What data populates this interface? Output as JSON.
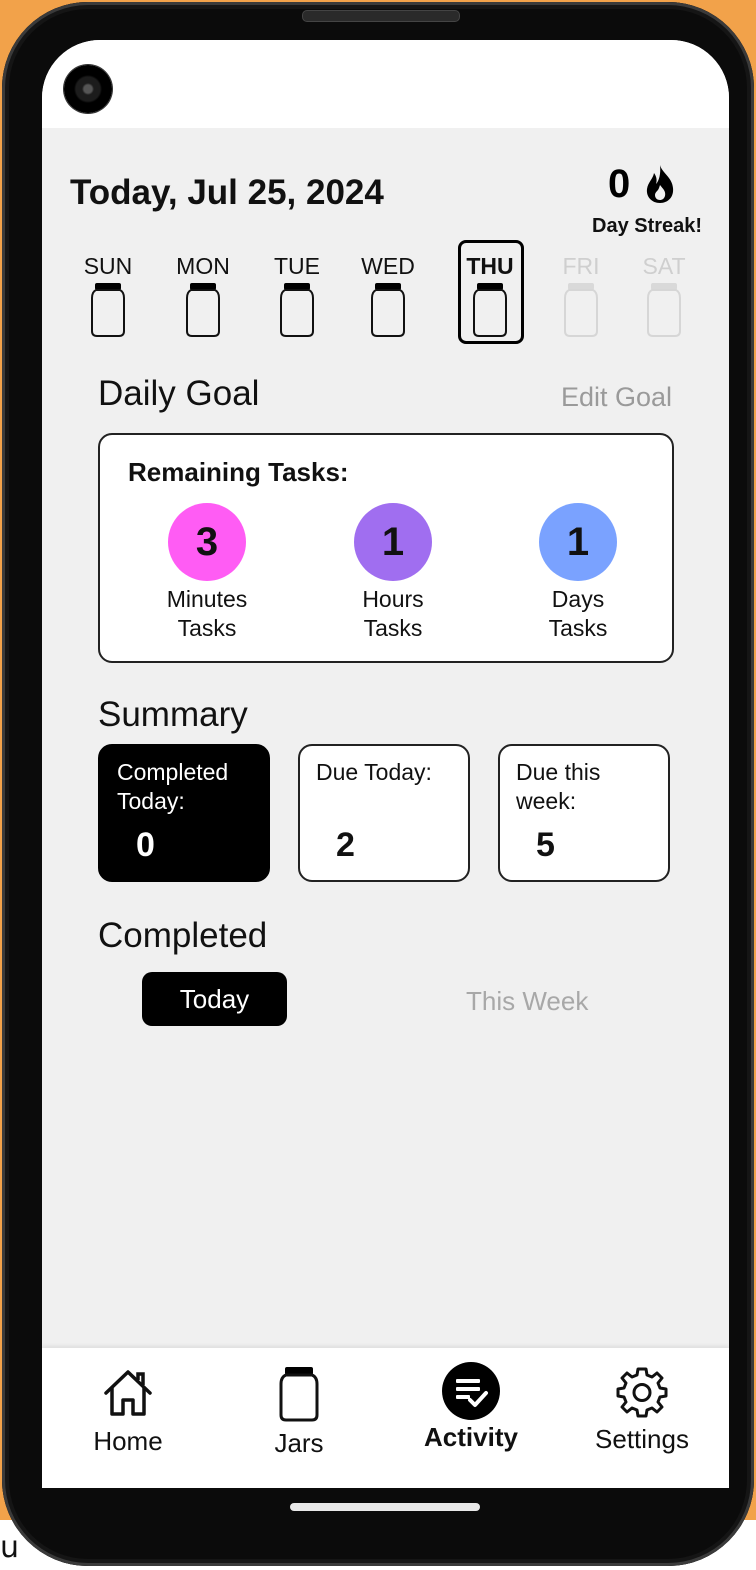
{
  "header": {
    "date": "Today, Jul 25, 2024",
    "streak_count": "0",
    "streak_label": "Day Streak!",
    "streak_icon": "flame-icon"
  },
  "week": [
    {
      "label": "SUN",
      "state": "filled"
    },
    {
      "label": "MON",
      "state": "filled"
    },
    {
      "label": "TUE",
      "state": "filled"
    },
    {
      "label": "WED",
      "state": "filled"
    },
    {
      "label": "THU",
      "state": "current"
    },
    {
      "label": "FRI",
      "state": "future"
    },
    {
      "label": "SAT",
      "state": "future"
    }
  ],
  "daily_goal": {
    "title": "Daily Goal",
    "edit_label": "Edit Goal",
    "card_heading": "Remaining Tasks:",
    "tasks": [
      {
        "count": "3",
        "label_line1": "Minutes",
        "label_line2": "Tasks",
        "color": "#ff5cf4"
      },
      {
        "count": "1",
        "label_line1": "Hours",
        "label_line2": "Tasks",
        "color": "#a06ef0"
      },
      {
        "count": "1",
        "label_line1": "Days",
        "label_line2": "Tasks",
        "color": "#7aa2ff"
      }
    ]
  },
  "summary": {
    "title": "Summary",
    "cards": [
      {
        "caption": "Completed Today:",
        "value": "0"
      },
      {
        "caption": "Due Today:",
        "value": "2"
      },
      {
        "caption": "Due this week:",
        "value": "5"
      }
    ]
  },
  "completed": {
    "title": "Completed",
    "tab_today": "Today",
    "tab_week": "This Week"
  },
  "nav": {
    "home": "Home",
    "jars": "Jars",
    "activity": "Activity",
    "settings": "Settings"
  },
  "colors": {
    "accent": "#000000",
    "muted": "#9a9a9a",
    "background": "#f0f0f0"
  }
}
